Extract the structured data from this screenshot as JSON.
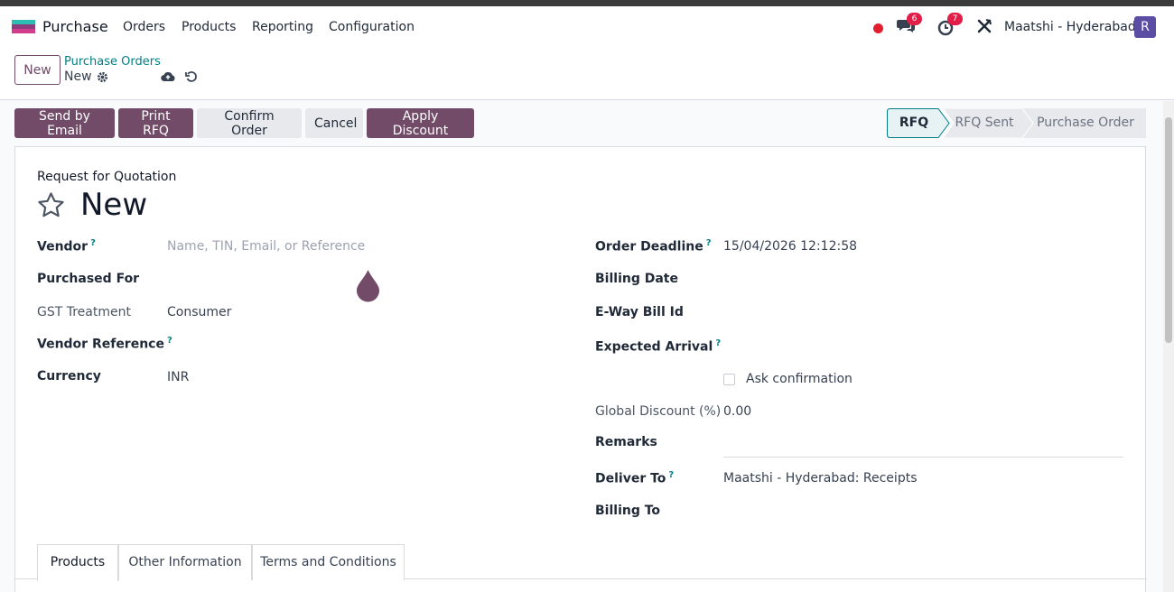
{
  "nav": {
    "app_name": "Purchase",
    "menus": [
      "Orders",
      "Products",
      "Reporting",
      "Configuration"
    ],
    "discuss_count": "6",
    "activity_count": "7",
    "company": "Maatshi - Hyderabad",
    "avatar_letter": "R"
  },
  "control": {
    "new_label": "New",
    "breadcrumb_parent": "Purchase Orders",
    "breadcrumb_current": "New"
  },
  "actions": {
    "send_by_email": "Send by Email",
    "print_rfq": "Print RFQ",
    "confirm_order": "Confirm Order",
    "cancel": "Cancel",
    "apply_discount": "Apply Discount"
  },
  "stages": [
    "RFQ",
    "RFQ Sent",
    "Purchase Order"
  ],
  "form": {
    "doc_type": "Request for Quotation",
    "doc_name": "New",
    "vendor_label": "Vendor",
    "vendor_placeholder": "Name, TIN, Email, or Reference",
    "purchased_for_label": "Purchased For",
    "gst_label": "GST Treatment",
    "gst_value": "Consumer",
    "vendor_ref_label": "Vendor Reference",
    "currency_label": "Currency",
    "currency_value": "INR",
    "order_deadline_label": "Order Deadline",
    "order_deadline_value": "15/04/2026 12:12:58",
    "billing_date_label": "Billing Date",
    "eway_label": "E-Way Bill Id",
    "expected_arrival_label": "Expected Arrival",
    "ask_confirmation_label": "Ask confirmation",
    "global_discount_label": "Global Discount (%)",
    "global_discount_value": "0.00",
    "remarks_label": "Remarks",
    "deliver_to_label": "Deliver To",
    "deliver_to_value": "Maatshi - Hyderabad: Receipts",
    "billing_to_label": "Billing To",
    "help_mark": "?"
  },
  "tabs": [
    "Products",
    "Other Information",
    "Terms and Conditions"
  ],
  "colors": {
    "brand": "#714b67",
    "link": "#017e84",
    "badge": "#e11d48"
  }
}
